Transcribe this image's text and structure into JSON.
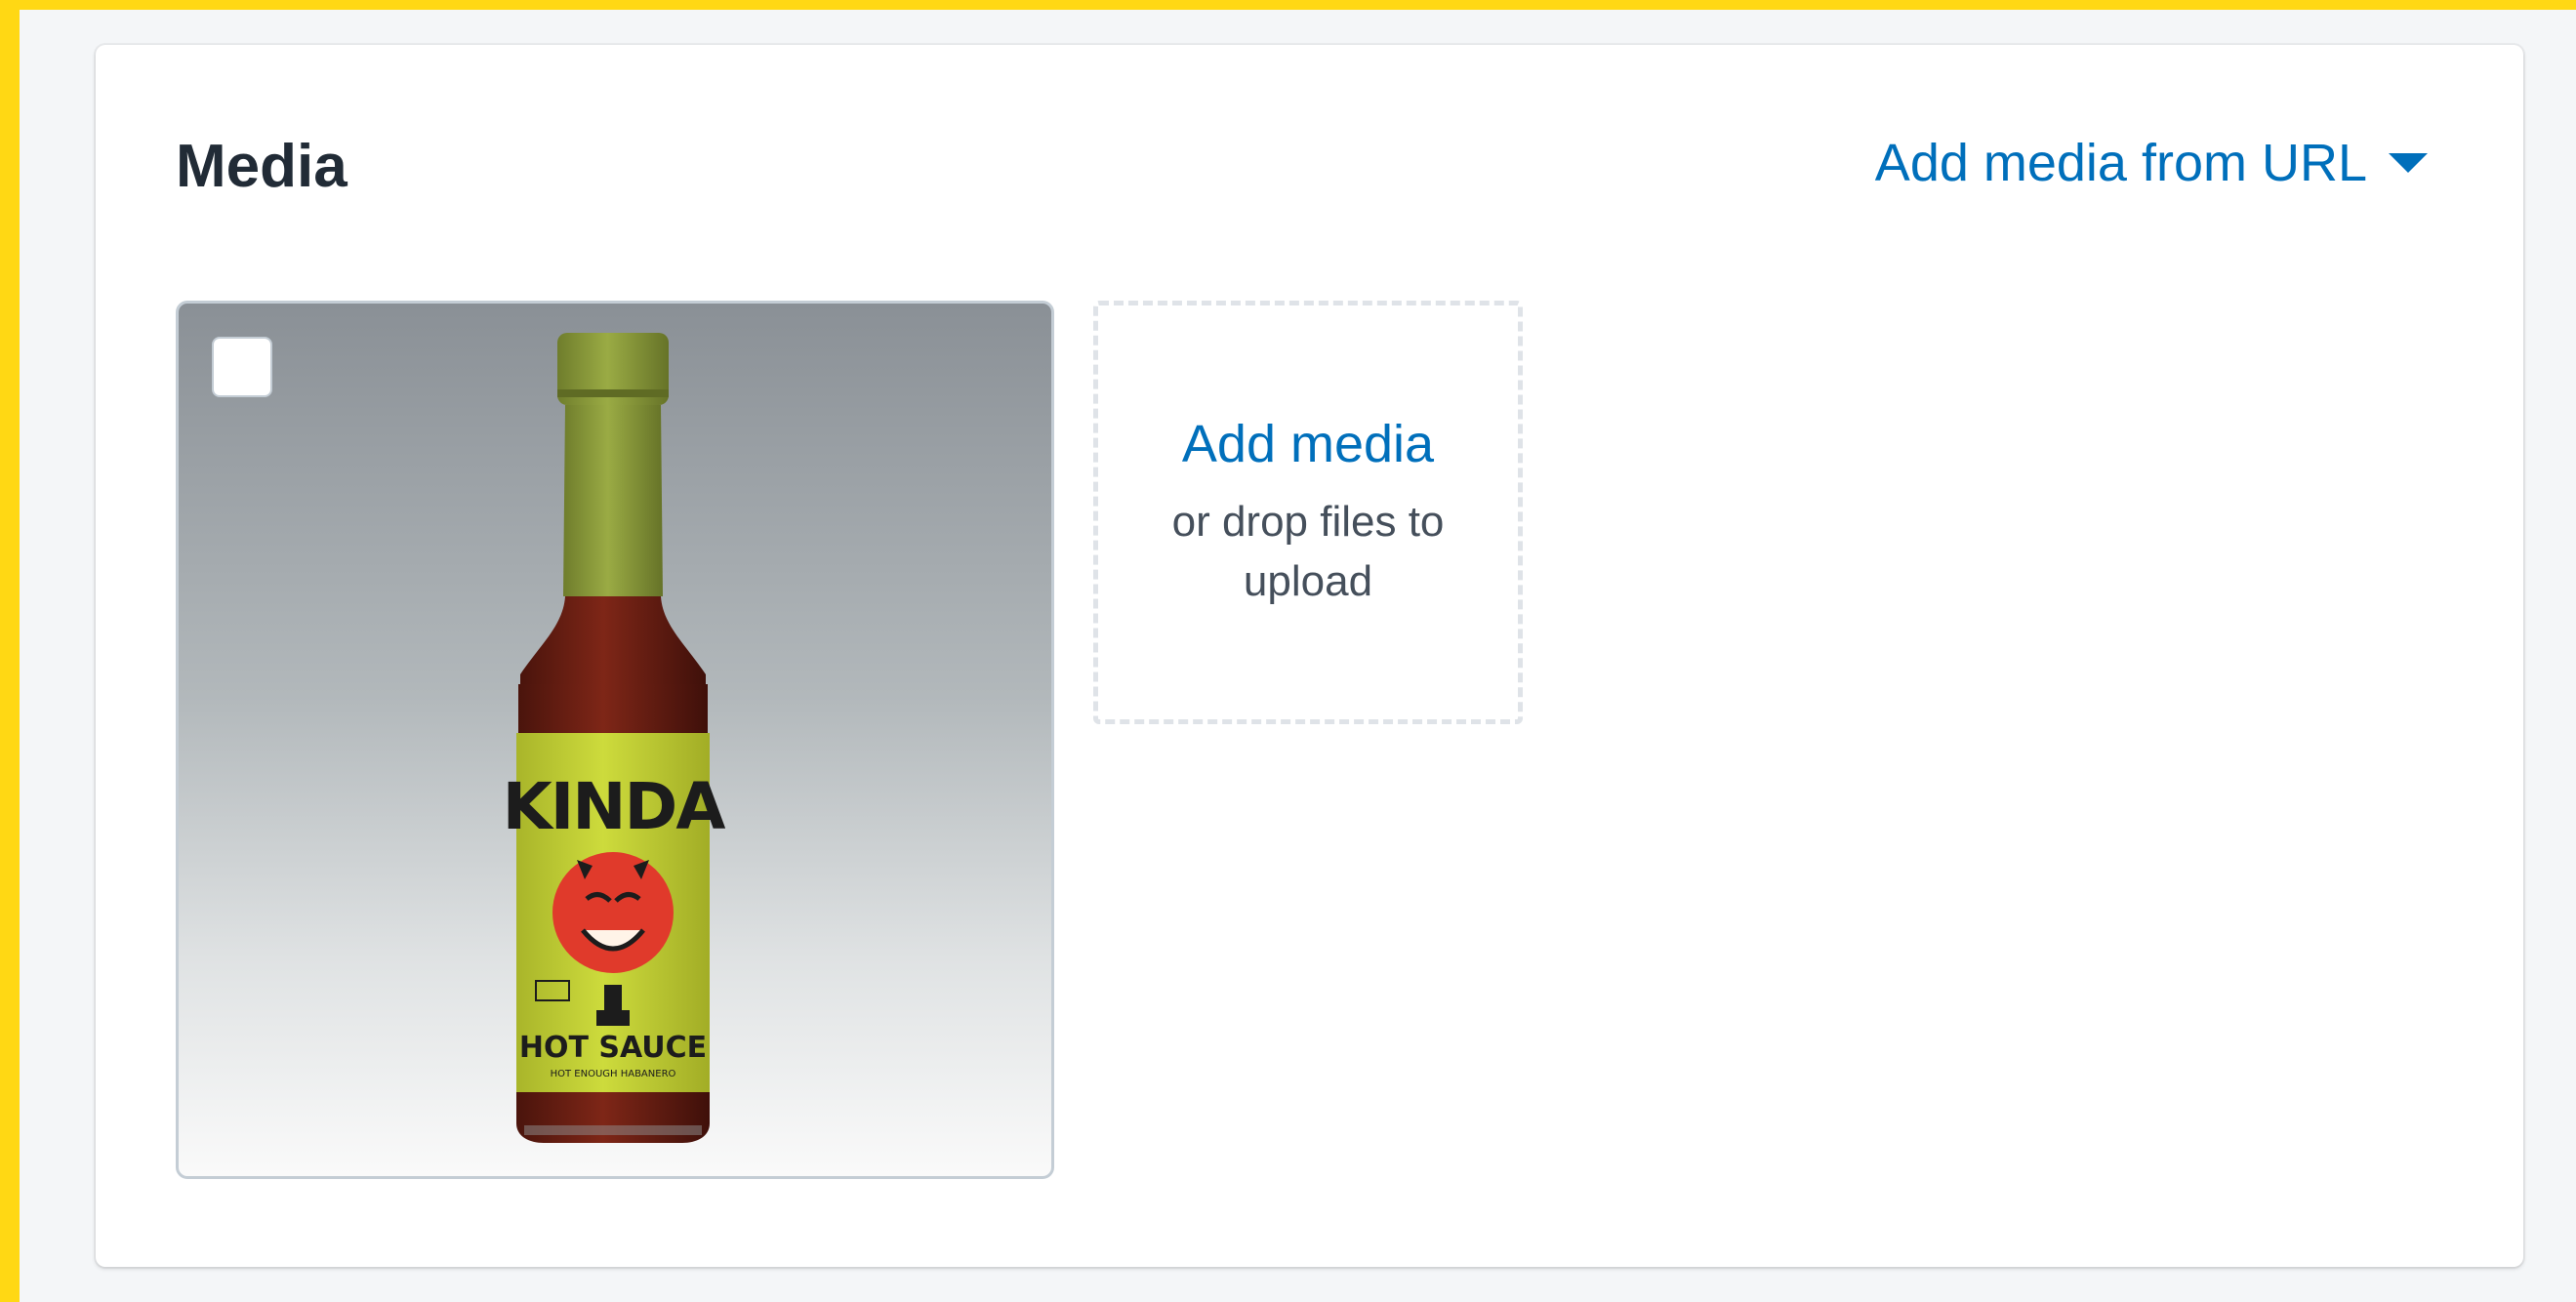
{
  "media_card": {
    "title": "Media",
    "add_from_url_label": "Add media from URL",
    "add_from_url_icon": "caret-down-icon"
  },
  "media_item": {
    "selected": false,
    "image_label": "KINDA",
    "image_subtitle": "HOT SAUCE",
    "image_tagline": "HOT ENOUGH HABANERO",
    "label_color": "#c3d22e",
    "sauce_color": "#6b1d12",
    "cap_color": "#8d9d3a"
  },
  "dropzone": {
    "link_label": "Add media",
    "hint": "or drop files to upload"
  },
  "colors": {
    "link": "#006fbb",
    "frame": "#ffd814",
    "heading": "#212b36"
  }
}
